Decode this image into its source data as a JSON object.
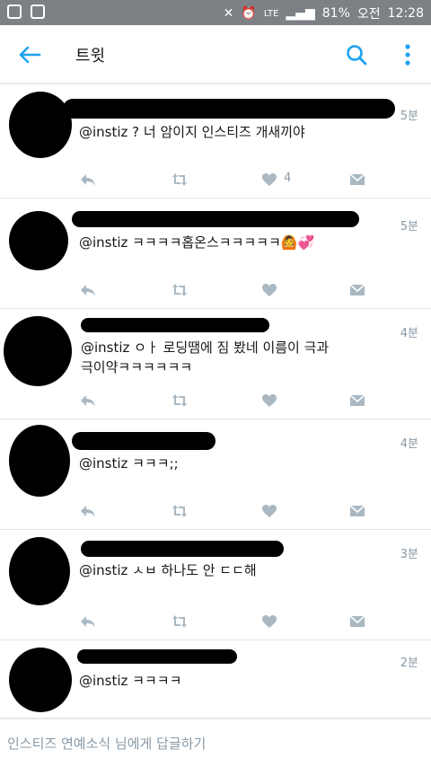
{
  "status": {
    "carrier": "LTE",
    "battery": "81%",
    "ampm": "오전",
    "time": "12:28"
  },
  "header": {
    "title": "트윗"
  },
  "tweets": [
    {
      "time": "5분",
      "text": "@instiz ? 너 암이지 인스티즈 개새끼야",
      "likes": "4"
    },
    {
      "time": "5분",
      "text": "@instiz ㅋㅋㅋㅋ홉온스ㅋㅋㅋㅋㅋ🙆💞",
      "likes": ""
    },
    {
      "time": "4분",
      "text": "@instiz ㅇㅏ 로딩땜에 짐 봤네 이름이 극과극이약ㅋㅋㅋㅋㅋㅋ",
      "likes": ""
    },
    {
      "time": "4분",
      "text": "@instiz ㅋㅋㅋ;;",
      "likes": ""
    },
    {
      "time": "3분",
      "text": "@instiz ㅅㅂ 하나도 안 ㄷㄷ해",
      "likes": ""
    },
    {
      "time": "2분",
      "text": "@instiz ㅋㅋㅋㅋ",
      "likes": ""
    }
  ],
  "reply": {
    "placeholder": "인스티즈 연예소식 님에게 답글하기"
  },
  "colors": {
    "accent": "#1da1f2",
    "icon": "#aab8c2",
    "text": "#14171a",
    "muted": "#8899a6"
  }
}
